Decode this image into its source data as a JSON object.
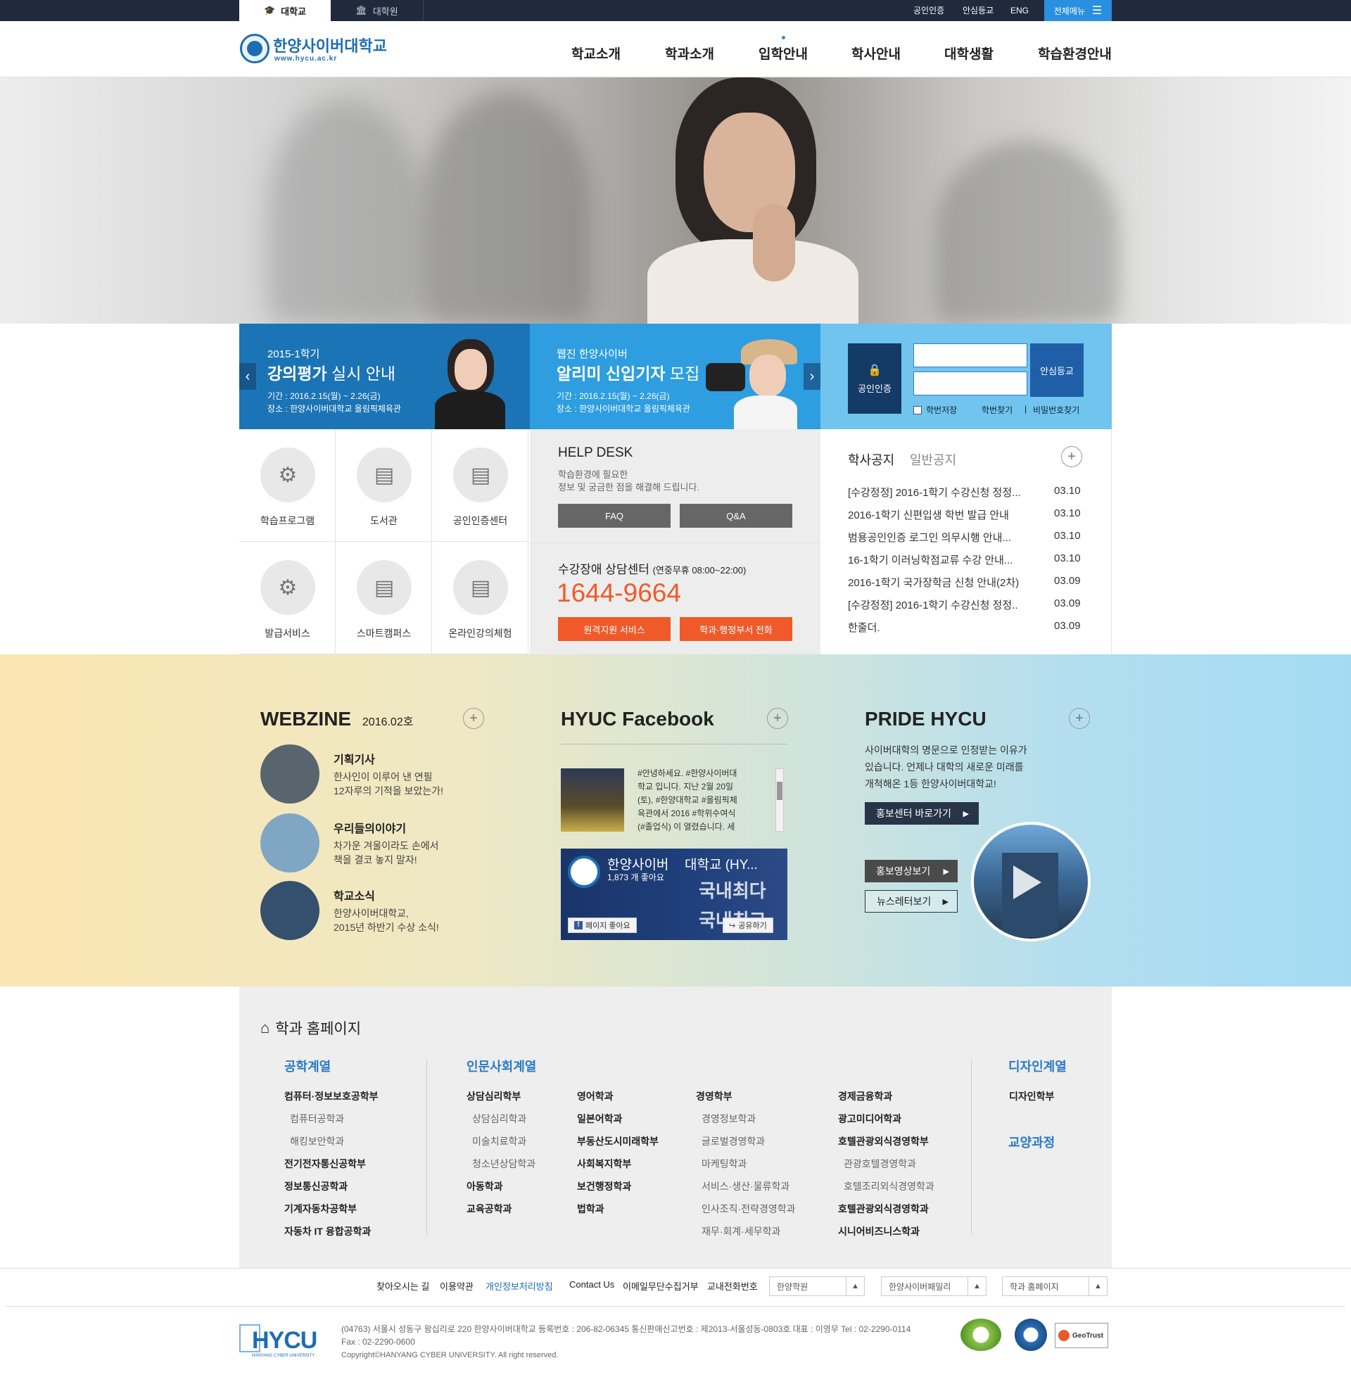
{
  "topbar": {
    "tabs": [
      "대학교",
      "대학원"
    ],
    "links": [
      "공인인증",
      "안심등교",
      "ENG"
    ],
    "all_menu": "전체메뉴"
  },
  "header": {
    "logo_name": "한양사이버대학교",
    "logo_url": "www.hycu.ac.kr",
    "nav": [
      "학교소개",
      "학과소개",
      "입학안내",
      "학사안내",
      "대학생활",
      "학습환경안내"
    ]
  },
  "banners": [
    {
      "subtitle": "2015-1학기",
      "title_bold": "강의평가",
      "title_rest": " 실시 안내",
      "period": "기간 : 2016.2.15(월) ~ 2.26(금)",
      "place": "장소 : 한양사이버대학교 올림픽체육관"
    },
    {
      "subtitle": "웹진 한양사이버",
      "title_bold": "알리미 신입기자",
      "title_rest": " 모집",
      "period": "기간 : 2016.2.15(월) ~ 2.26(금)",
      "place": "장소 : 한양사이버대학교 올림픽체육관"
    }
  ],
  "login": {
    "cert_button": "공인인증",
    "safe_button": "안심등교",
    "save_id": "학번저장",
    "find_id": "학번찾기",
    "find_pw": "비밀번호찾기"
  },
  "quick_links": [
    "학습프로그램",
    "도서관",
    "공인인증센터",
    "발급서비스",
    "스마트캠퍼스",
    "온라인강의체험"
  ],
  "helpdesk": {
    "title": "HELP DESK",
    "desc_line1": "학습환경에 필요한",
    "desc_line2": "정보 및 궁금한 점을 해결해 드립니다.",
    "faq": "FAQ",
    "qna": "Q&A"
  },
  "callcenter": {
    "title": "수강장애 상담센터",
    "hours": "(연중무휴 08:00~22:00)",
    "phone": "1644-9664",
    "remote_btn": "원격지원 서비스",
    "dept_btn": "학과·행정부서 전화"
  },
  "notice": {
    "tab_active": "학사공지",
    "tab_inactive": "일반공지",
    "items": [
      {
        "title": "[수강정정] 2016-1학기 수강신청 정정...",
        "date": "03.10"
      },
      {
        "title": "2016-1학기 신편입생 학번 발급 안내",
        "date": "03.10"
      },
      {
        "title": "범용공인인증 로그인 의무시행 안내...",
        "date": "03.10"
      },
      {
        "title": "16-1학기 이러닝학점교류 수강 안내...",
        "date": "03.10"
      },
      {
        "title": "2016-1학기 국가장학금 신청 안내(2차)",
        "date": "03.09"
      },
      {
        "title": "[수강정정] 2016-1학기 수강신청 정정..",
        "date": "03.09"
      },
      {
        "title": "한줄더.",
        "date": "03.09"
      }
    ]
  },
  "webzine": {
    "title": "WEBZINE",
    "issue": "2016.02호",
    "items": [
      {
        "title": "기획기사",
        "line1": "한사인이 이루어 낸 연필",
        "line2": "12자루의 기적을 보았는가!"
      },
      {
        "title": "우리들의이야기",
        "line1": "차가운 겨울이라도 손에서",
        "line2": "책을 결코 놓지 말자!"
      },
      {
        "title": "학교소식",
        "line1": "한양사이버대학교,",
        "line2": "2015년 하반기 수상 소식!"
      }
    ]
  },
  "facebook": {
    "title": "HYUC Facebook",
    "post": [
      "#안녕하세요. #한양사이버대",
      "학교 입니다. 지난 2월 20일",
      "(토), #한양대학교 #올림픽체",
      "육관에서 2016 #학위수여식",
      "(#졸업식) 이 열렸습니다. 세"
    ],
    "page_name": "한양사이버",
    "page_name2": "대학교 (HY...",
    "likes": "1,873 개 좋아요",
    "like_btn": "페이지 좋아요",
    "share_btn": "공유하기",
    "img_text1": "국내최다",
    "img_text2": "국내최고"
  },
  "pride": {
    "title": "PRIDE HYCU",
    "line1": "사이버대학의 명문으로 인정받는 이유가",
    "line2": "있습니다. 언제나 대학의 새로운 미래를",
    "line3": "개척해온 1등 한양사이버대학교!",
    "btn_pr": "홍보센터 바로가기",
    "btn_video": "홍보영상보기",
    "btn_news": "뉴스레터보기"
  },
  "departments": {
    "title": "학과 홈페이지",
    "eng": {
      "cat": "공학계열",
      "items": [
        {
          "name": "컴퓨터·정보보호공학부",
          "sub": false
        },
        {
          "name": "컴퓨터공학과",
          "sub": true
        },
        {
          "name": "해킹보안학과",
          "sub": true
        },
        {
          "name": "전기전자통신공학부",
          "sub": false
        },
        {
          "name": "정보통신공학과",
          "sub": false
        },
        {
          "name": "기계자동차공학부",
          "sub": false
        },
        {
          "name": "자동차 IT 융합공학과",
          "sub": false
        }
      ]
    },
    "hum": {
      "cat": "인문사회계열",
      "col1": [
        {
          "name": "상담심리학부",
          "sub": false
        },
        {
          "name": "상담심리학과",
          "sub": true
        },
        {
          "name": "미술치료학과",
          "sub": true
        },
        {
          "name": "청소년상담학과",
          "sub": true
        },
        {
          "name": "아동학과",
          "sub": false
        },
        {
          "name": "교육공학과",
          "sub": false
        }
      ],
      "col2": [
        {
          "name": "영어학과",
          "sub": false
        },
        {
          "name": "일본어학과",
          "sub": false
        },
        {
          "name": "부동산도시미래학부",
          "sub": false
        },
        {
          "name": "사회복지학부",
          "sub": false
        },
        {
          "name": "보건행정학과",
          "sub": false
        },
        {
          "name": "법학과",
          "sub": false
        }
      ],
      "col3": [
        {
          "name": "경영학부",
          "sub": false
        },
        {
          "name": "경영정보학과",
          "sub": true
        },
        {
          "name": "글로벌경영학과",
          "sub": true
        },
        {
          "name": "마케팅학과",
          "sub": true
        },
        {
          "name": "서비스·생산·물류학과",
          "sub": true
        },
        {
          "name": "인사조직·전략경영학과",
          "sub": true
        },
        {
          "name": "재무·회계·세무학과",
          "sub": true
        }
      ],
      "col4": [
        {
          "name": "경제금융학과",
          "sub": false
        },
        {
          "name": "광고미디어학과",
          "sub": false
        },
        {
          "name": "호텔관광외식경영학부",
          "sub": false
        },
        {
          "name": "관광호텔경영학과",
          "sub": true
        },
        {
          "name": "호텔조리외식경영학과",
          "sub": true
        },
        {
          "name": "호텔관광외식경영학과",
          "sub": false
        },
        {
          "name": "시니어비즈니스학과",
          "sub": false
        }
      ]
    },
    "design": {
      "cat": "디자인계열",
      "items": [
        "디자인학부"
      ]
    },
    "liberal": {
      "cat": "교양과정"
    }
  },
  "footer": {
    "links": [
      "찾아오시는 길",
      "이용약관",
      "개인정보처리방침",
      "Contact Us",
      "이메일무단수집거부",
      "교내전화번호"
    ],
    "selects": [
      "한양학원",
      "한양사이버패밀리",
      "학과 홈페이지"
    ],
    "logo": "HYCU",
    "logo_sub": "HANYANG CYBER UNIVERSITY",
    "address": "(04763) 서울시 성동구 왕십리로 220 한양사이버대학교   등록번호 : 206-82-06345   통신판매신고번호 : 제2013-서울성동-0803호 대표 : 이영무   Tel : 02-2290-0114",
    "fax": "Fax : 02-2290-0600",
    "copyright": "Copyright©HANYANG CYBER UNIVERSITY. All right reserved.",
    "badge_geotrust": "GeoTrust"
  },
  "colors": {
    "topbar": "#1f2a3c",
    "accent_blue": "#2a8fe0",
    "banner1": "#1b74b5",
    "banner2": "#2e9ee0",
    "phone_orange": "#f05a2a"
  }
}
